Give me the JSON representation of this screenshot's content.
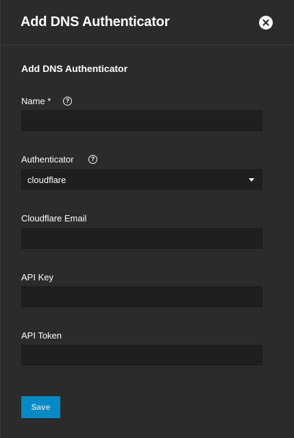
{
  "header": {
    "title": "Add DNS Authenticator",
    "close_icon": "close-icon"
  },
  "form": {
    "section_title": "Add DNS Authenticator",
    "name": {
      "label": "Name *",
      "value": "",
      "help_icon": "help-icon"
    },
    "authenticator": {
      "label": "Authenticator",
      "selected": "cloudflare",
      "help_icon": "help-icon"
    },
    "cloudflare_email": {
      "label": "Cloudflare Email",
      "value": ""
    },
    "api_key": {
      "label": "API Key",
      "value": ""
    },
    "api_token": {
      "label": "API Token",
      "value": ""
    },
    "save_label": "Save"
  },
  "colors": {
    "background": "#2b2b2b",
    "input_background": "#1f1f1f",
    "primary": "#0095d5",
    "text": "#ffffff"
  }
}
